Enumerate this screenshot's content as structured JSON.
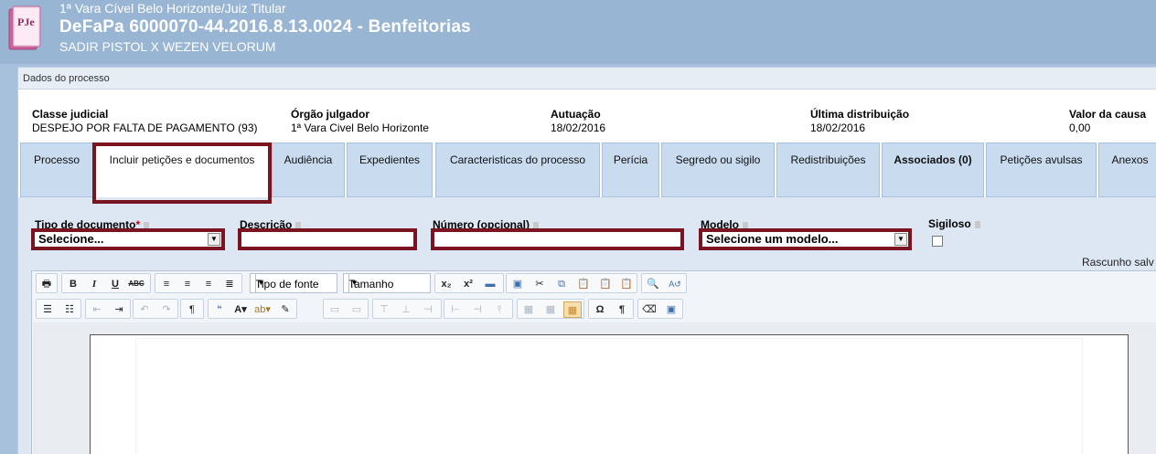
{
  "header": {
    "court": "1ª Vara Cível Belo Horizonte/Juiz Titular",
    "process_title": "DeFaPa 6000070-44.2016.8.13.0024 - Benfeitorias",
    "parties": "SADIR PISTOL X WEZEN VELORUM",
    "logo_text": "PJe"
  },
  "panel": {
    "title": "Dados do processo"
  },
  "process_info": {
    "classe": {
      "label": "Classe judicial",
      "value": "DESPEJO POR FALTA DE PAGAMENTO (93)"
    },
    "orgao": {
      "label": "Órgão julgador",
      "value": "1ª Vara Civel Belo Horizonte"
    },
    "autuacao": {
      "label": "Autuação",
      "value": "18/02/2016"
    },
    "distribuicao": {
      "label": "Última distribuição",
      "value": "18/02/2016"
    },
    "valor": {
      "label": "Valor da causa",
      "value": "0,00"
    }
  },
  "tabs": [
    {
      "label": "Processo"
    },
    {
      "label": "Incluir petições e documentos"
    },
    {
      "label": "Audiência"
    },
    {
      "label": "Expedientes"
    },
    {
      "label": "Caracteristicas do processo"
    },
    {
      "label": "Perícia"
    },
    {
      "label": "Segredo ou sigilo"
    },
    {
      "label": "Redistribuições"
    },
    {
      "label": "Associados (0)"
    },
    {
      "label": "Petições avulsas"
    },
    {
      "label": "Anexos"
    }
  ],
  "form": {
    "tipo_documento": {
      "label": "Tipo de documento",
      "required_mark": "*",
      "value": "Selecione..."
    },
    "descricao": {
      "label": "Descrição",
      "value": ""
    },
    "numero": {
      "label": "Número (opcional)",
      "value": ""
    },
    "modelo": {
      "label": "Modelo",
      "value": "Selecione um modelo..."
    },
    "sigiloso": {
      "label": "Sigiloso",
      "checked": false
    },
    "rascunho": "Rascunho salv"
  },
  "editor": {
    "font_family": "Tipo de fonte",
    "font_size": "Tamanho"
  },
  "colors": {
    "highlight_border": "#7a1420",
    "header_bg": "#99b5d4",
    "tab_bg": "#c8dbef"
  }
}
